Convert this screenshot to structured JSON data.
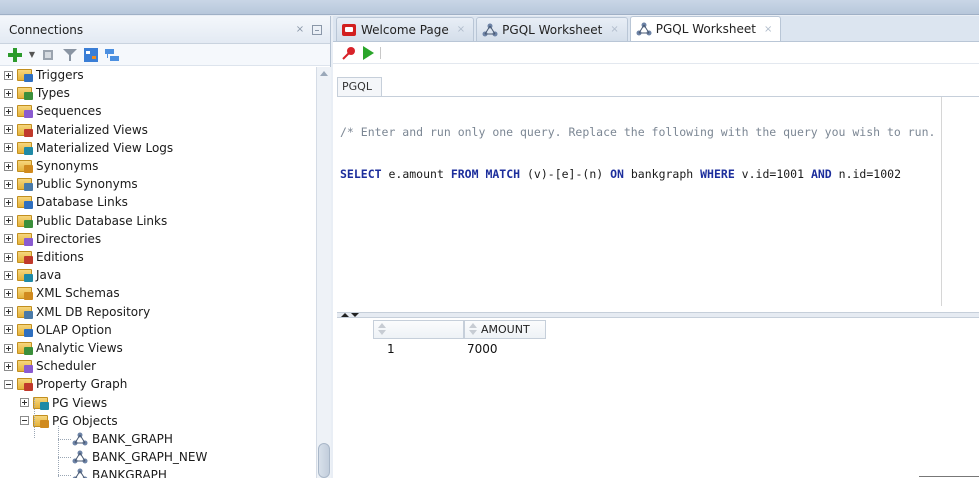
{
  "connections_panel": {
    "title": "Connections",
    "close_glyph": "×",
    "toolbar": [
      "add-connection-icon",
      "refresh-icon",
      "filter-icon",
      "schema-browser-icon",
      "schema-tree-icon"
    ],
    "tree": [
      {
        "label": "Triggers",
        "expanded": false,
        "depth": 1
      },
      {
        "label": "Types",
        "expanded": false,
        "depth": 1
      },
      {
        "label": "Sequences",
        "expanded": false,
        "depth": 1
      },
      {
        "label": "Materialized Views",
        "expanded": false,
        "depth": 1
      },
      {
        "label": "Materialized View Logs",
        "expanded": false,
        "depth": 1
      },
      {
        "label": "Synonyms",
        "expanded": false,
        "depth": 1
      },
      {
        "label": "Public Synonyms",
        "expanded": false,
        "depth": 1
      },
      {
        "label": "Database Links",
        "expanded": false,
        "depth": 1
      },
      {
        "label": "Public Database Links",
        "expanded": false,
        "depth": 1
      },
      {
        "label": "Directories",
        "expanded": false,
        "depth": 1
      },
      {
        "label": "Editions",
        "expanded": false,
        "depth": 1
      },
      {
        "label": "Java",
        "expanded": false,
        "depth": 1
      },
      {
        "label": "XML Schemas",
        "expanded": false,
        "depth": 1
      },
      {
        "label": "XML DB Repository",
        "expanded": false,
        "depth": 1
      },
      {
        "label": "OLAP Option",
        "expanded": false,
        "depth": 1
      },
      {
        "label": "Analytic Views",
        "expanded": false,
        "depth": 1
      },
      {
        "label": "Scheduler",
        "expanded": false,
        "depth": 1
      },
      {
        "label": "Property Graph",
        "expanded": true,
        "depth": 1
      },
      {
        "label": "PG Views",
        "expanded": false,
        "depth": 2
      },
      {
        "label": "PG Objects",
        "expanded": true,
        "depth": 2
      },
      {
        "label": "BANK_GRAPH",
        "depth": 3
      },
      {
        "label": "BANK_GRAPH_NEW",
        "depth": 3
      },
      {
        "label": "BANKGRAPH",
        "depth": 3
      }
    ]
  },
  "tabs": [
    {
      "label": "Welcome Page",
      "icon": "welcome-page-icon",
      "active": false
    },
    {
      "label": "PGQL Worksheet",
      "icon": "pgql-worksheet-icon",
      "active": false
    },
    {
      "label": "PGQL Worksheet",
      "icon": "pgql-worksheet-icon",
      "active": true
    }
  ],
  "worksheet": {
    "toolbar": [
      "pin-icon",
      "run-icon"
    ],
    "subtab_label": "PGQL",
    "comment_line": "/* Enter and run only one query. Replace the following with the query you wish to run.",
    "query_tokens": [
      {
        "t": "SELECT",
        "k": "kw"
      },
      {
        "t": " e.",
        "k": "plain"
      },
      {
        "t": "amount",
        "k": "plain"
      },
      {
        "t": " ",
        "k": "plain"
      },
      {
        "t": "FROM",
        "k": "kw"
      },
      {
        "t": " ",
        "k": "plain"
      },
      {
        "t": "MATCH",
        "k": "kw"
      },
      {
        "t": " (v)-[e]-(n) ",
        "k": "plain"
      },
      {
        "t": "ON",
        "k": "kw"
      },
      {
        "t": " bankgraph ",
        "k": "plain"
      },
      {
        "t": "WHERE",
        "k": "kw"
      },
      {
        "t": " v.id",
        "k": "plain"
      },
      {
        "t": "=",
        "k": "plain"
      },
      {
        "t": "1001",
        "k": "plain"
      },
      {
        "t": " ",
        "k": "plain"
      },
      {
        "t": "AND",
        "k": "kw"
      },
      {
        "t": " n.id",
        "k": "plain"
      },
      {
        "t": "=",
        "k": "plain"
      },
      {
        "t": "1002",
        "k": "plain"
      }
    ]
  },
  "results": {
    "columns": [
      "",
      "AMOUNT"
    ],
    "rows": [
      {
        "row_num": "1",
        "amount": "7000"
      }
    ]
  }
}
